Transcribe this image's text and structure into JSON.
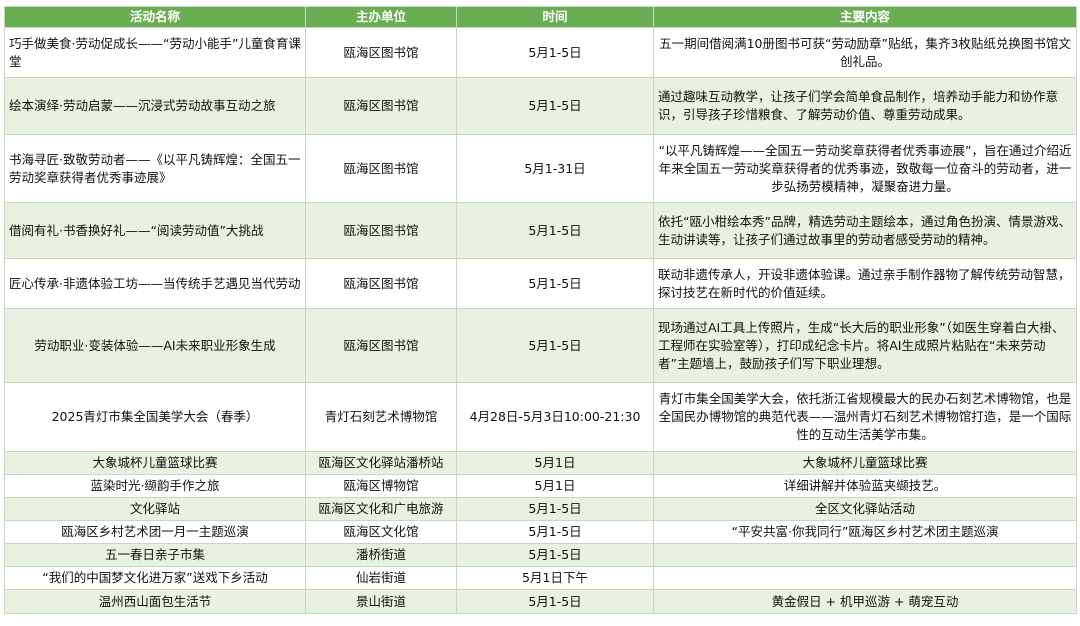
{
  "headers": [
    "活动名称",
    "主办单位",
    "时间",
    "主要内容"
  ],
  "rows": [
    {
      "name": "巧手做美食·劳动促成长——“劳动小能手”儿童食育课堂",
      "org": "瓯海区图书馆",
      "time": "5月1-5日",
      "content": "五一期间借阅满10册图书可获“劳动励章”贴纸，集齐3枚贴纸兑换图书馆文创礼品。"
    },
    {
      "name": "绘本演绎·劳动启蒙——沉浸式劳动故事互动之旅",
      "org": "瓯海区图书馆",
      "time": "5月1-5日",
      "content": "通过趣味互动教学，让孩子们学会简单食品制作，培养动手能力和协作意识，引导孩子珍惜粮食、了解劳动价值、尊重劳动成果。"
    },
    {
      "name": "书海寻匠·致敬劳动者——《以平凡铸辉煌：全国五一劳动奖章获得者优秀事迹展》",
      "org": "瓯海区图书馆",
      "time": "5月1-31日",
      "content": "“以平凡铸辉煌——全国五一劳动奖章获得者优秀事迹展”，旨在通过介绍近年来全国五一劳动奖章获得者的优秀事迹，致敬每一位奋斗的劳动者，进一步弘扬劳模精神，凝聚奋进力量。"
    },
    {
      "name": "借阅有礼·书香换好礼——“阅读劳动值”大挑战",
      "org": "瓯海区图书馆",
      "time": "5月1-5日",
      "content": "依托“瓯小柑绘本秀”品牌，精选劳动主题绘本，通过角色扮演、情景游戏、生动讲读等，让孩子们通过故事里的劳动者感受劳动的精神。"
    },
    {
      "name": "匠心传承·非遗体验工坊——当传统手艺遇见当代劳动",
      "org": "瓯海区图书馆",
      "time": "5月1-5日",
      "content": "联动非遗传承人，开设非遗体验课。通过亲手制作器物了解传统劳动智慧，探讨技艺在新时代的价值延续。"
    },
    {
      "name": "劳动职业·变装体验——AI未来职业形象生成",
      "org": "瓯海区图书馆",
      "time": "5月1-5日",
      "content": "现场通过AI工具上传照片，生成“长大后的职业形象”（如医生穿着白大褂、工程师在实验室等），打印成纪念卡片。将AI生成照片粘贴在“未来劳动者”主题墙上，鼓励孩子们写下职业理想。"
    },
    {
      "name": "2025青灯市集全国美学大会（春季）",
      "org": "青灯石刻艺术博物馆",
      "time": "4月28日-5月3日10:00-21:30",
      "content": "青灯市集全国美学大会，依托浙江省规模最大的民办石刻艺术博物馆，也是全国民办博物馆的典范代表——温州青灯石刻艺术博物馆打造，是一个国际性的互动生活美学市集。"
    },
    {
      "name": "大象城杯儿童篮球比赛",
      "org": "瓯海区文化驿站潘桥站",
      "time": "5月1日",
      "content": "大象城杯儿童篮球比赛"
    },
    {
      "name": "蓝染时光·缬韵手作之旅",
      "org": "瓯海区博物馆",
      "time": "5月1日",
      "content": "详细讲解并体验蓝夹缬技艺。"
    },
    {
      "name": "文化驿站",
      "org": "瓯海区文化和广电旅游",
      "time": "5月1-5日",
      "content": "全区文化驿站活动"
    },
    {
      "name": "瓯海区乡村艺术团一月一主题巡演",
      "org": "瓯海区文化馆",
      "time": "5月1-5日",
      "content": "“平安共富·你我同行”瓯海区乡村艺术团主题巡演"
    },
    {
      "name": "五一春日亲子市集",
      "org": "潘桥街道",
      "time": "5月1-5日",
      "content": ""
    },
    {
      "name": "“我们的中国梦文化进万家”送戏下乡活动",
      "org": "仙岩街道",
      "time": "5月1日下午",
      "content": ""
    },
    {
      "name": "温州西山面包生活节",
      "org": "景山街道",
      "time": "5月1-5日",
      "content": "黄金假日 + 机甲巡游 + 萌宠互动"
    }
  ]
}
